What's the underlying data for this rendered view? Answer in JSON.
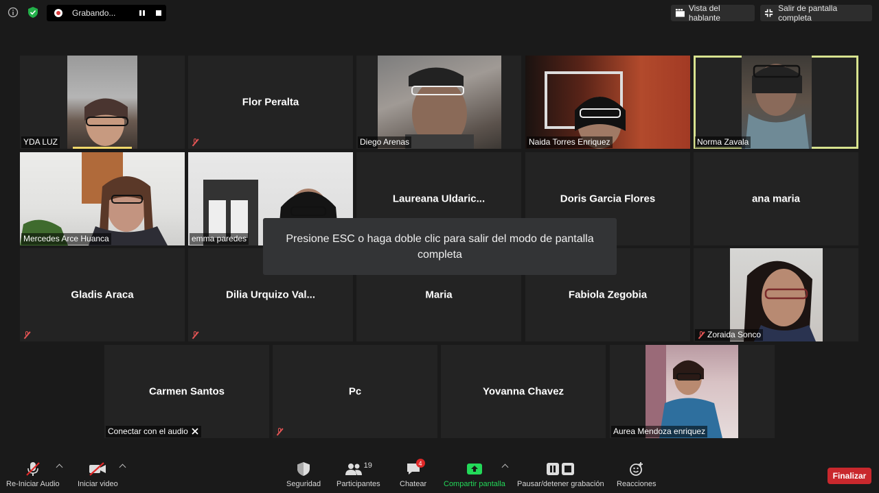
{
  "top": {
    "recording_label": "Grabando...",
    "speaker_view_label": "Vista del hablante",
    "exit_fullscreen_label": "Salir de pantalla completa"
  },
  "tiles": [
    {
      "name": "YDA LUZ"
    },
    {
      "name": "Flor Peralta"
    },
    {
      "name": "Diego Arenas"
    },
    {
      "name": "Naida Torres Enriquez"
    },
    {
      "name": "Norma Zavala"
    },
    {
      "name": "Mercedes Arce Huanca"
    },
    {
      "name": "emma paredes"
    },
    {
      "name": "Laureana  Uldaric..."
    },
    {
      "name": "Doris Garcia Flores"
    },
    {
      "name": "ana maria"
    },
    {
      "name": "Gladis Araca"
    },
    {
      "name": "Dilia  Urquizo  Val..."
    },
    {
      "name": "Maria"
    },
    {
      "name": "Fabiola Zegobia"
    },
    {
      "name": "Zoraida Sonco"
    },
    {
      "name": "Carmen Santos"
    },
    {
      "name": "Pc"
    },
    {
      "name": "Yovanna Chavez"
    },
    {
      "name": "Aurea Mendoza enriquez"
    }
  ],
  "audio_connect_label": "Conectar con el audio",
  "toast_text": "Presione ESC o haga doble clic para salir del modo de pantalla completa",
  "toolbar": {
    "audio_label": "Re-Iniciar Audio",
    "video_label": "Iniciar video",
    "security_label": "Seguridad",
    "participants_label": "Participantes",
    "participants_count": "19",
    "chat_label": "Chatear",
    "chat_badge": "4",
    "share_label": "Compartir pantalla",
    "record_label": "Pausar/detener grabación",
    "reactions_label": "Reacciones",
    "end_label": "Finalizar"
  },
  "colors": {
    "active_speaker": "#d8e38f",
    "share_green": "#23d959",
    "end_red": "#c9282d",
    "muted_red": "#e35454"
  }
}
